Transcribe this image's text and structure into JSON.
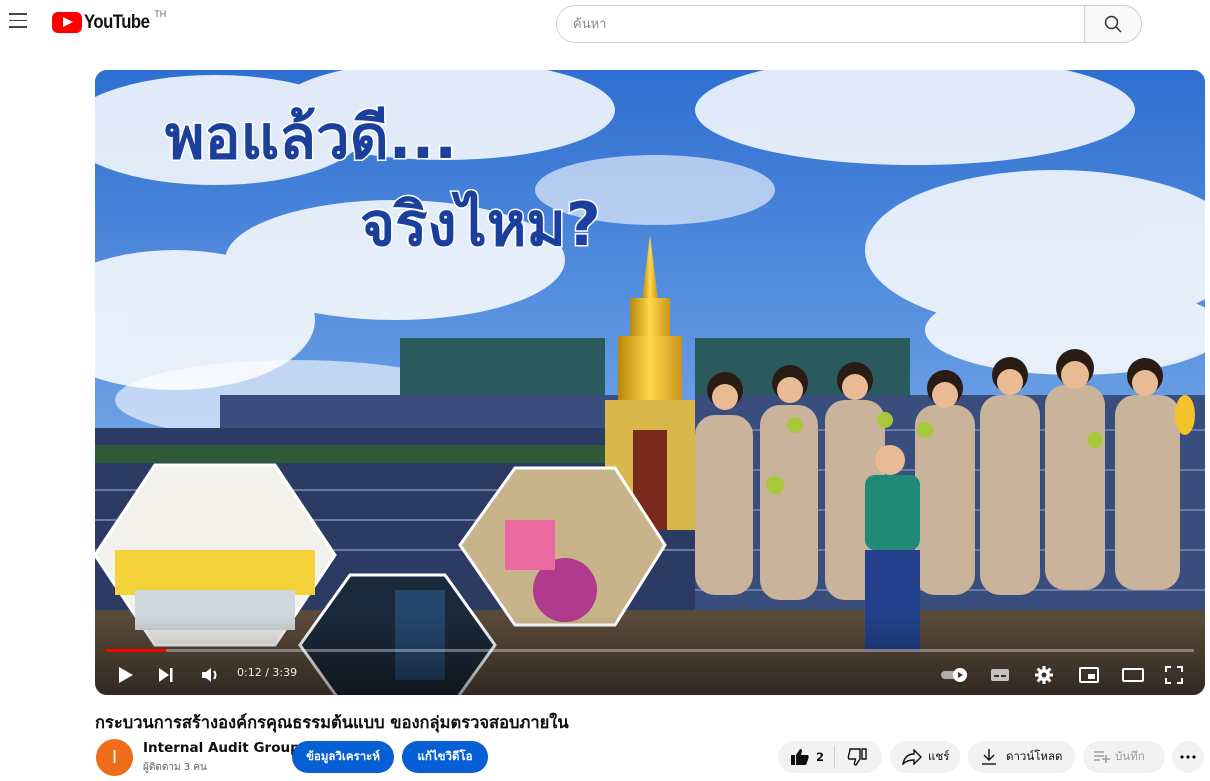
{
  "header": {
    "logo_text": "YouTube",
    "country_code": "TH",
    "search_placeholder": "ค้นหา"
  },
  "video": {
    "overlay_line1": "พอแล้วดี...",
    "overlay_line2": "จริงไหม?",
    "current_time": "0:12",
    "duration": "3:39",
    "time_display": "0:12 / 3:39",
    "progress": 0.055
  },
  "info": {
    "title": "กระบวนการสร้างองค์กรคุณธรรมต้นแบบ ของกลุ่มตรวจสอบภายใน",
    "channel_name": "Internal Audit Group",
    "channel_initial": "I",
    "subscribers": "ผู้ติดตาม 3 คน",
    "analytics_label": "ข้อมูลวิเคราะห์",
    "edit_video_label": "แก้ไขวิดีโอ",
    "like_count": "2",
    "share_label": "แชร์",
    "download_label": "ดาวน์โหลด",
    "save_label": "บันทึก"
  },
  "colors": {
    "brand_red": "#ff0000",
    "progress_red": "#ff0000",
    "button_blue": "#065fd4",
    "avatar_orange": "#ef6c1a",
    "overlay_text_blue": "#1a3f9c"
  },
  "icons": [
    "menu-icon",
    "youtube-logo-icon",
    "search-icon",
    "play-icon",
    "next-icon",
    "volume-icon",
    "autoplay-toggle-icon",
    "subtitles-icon",
    "settings-gear-icon",
    "miniplayer-icon",
    "theater-mode-icon",
    "fullscreen-icon",
    "like-icon",
    "dislike-icon",
    "share-icon",
    "download-icon",
    "save-playlist-icon",
    "more-icon"
  ]
}
